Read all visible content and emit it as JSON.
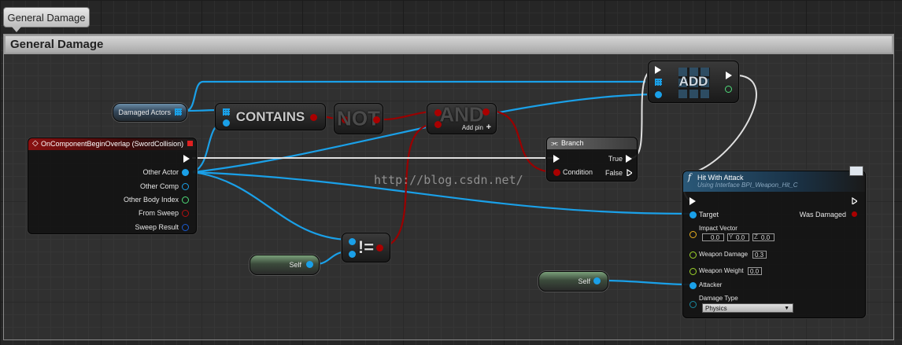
{
  "tab": {
    "label": "General Damage"
  },
  "comment": {
    "title": "General Damage"
  },
  "nodes": {
    "damaged_actors": {
      "label": "Damaged Actors"
    },
    "contains": {
      "label": "CONTAINS"
    },
    "not": {
      "label": "NOT"
    },
    "and": {
      "label": "AND",
      "add_pin": "Add pin"
    },
    "add": {
      "label": "ADD"
    },
    "branch": {
      "title": "Branch",
      "condition": "Condition",
      "true_label": "True",
      "false_label": "False"
    },
    "event": {
      "title": "OnComponentBeginOverlap (SwordCollision)",
      "pins": [
        "Other Actor",
        "Other Comp",
        "Other Body Index",
        "From Sweep",
        "Sweep Result"
      ]
    },
    "self1": {
      "label": "Self"
    },
    "self2": {
      "label": "Self"
    },
    "not_equal": {
      "label": "!="
    },
    "hit": {
      "title": "Hit With Attack",
      "subtitle": "Using Interface BPI_Weapon_Hit_C",
      "target": "Target",
      "was_damaged": "Was Damaged",
      "impact_vector": "Impact Vector",
      "x_label": "X",
      "x": "0.0",
      "y_label": "Y",
      "y": "0.0",
      "z_label": "Z",
      "z": "0.0",
      "weapon_damage": "Weapon Damage",
      "weapon_damage_value": "0.3",
      "weapon_weight": "Weapon Weight",
      "weapon_weight_value": "0.0",
      "attacker": "Attacker",
      "damage_type": "Damage Type",
      "damage_type_value": "Physics"
    }
  },
  "watermark": "http://blog.csdn.net/",
  "colors": {
    "object_pin": "#1aa0e8",
    "bool_pin": "#a00000",
    "exec_wire": "#e0e0e0",
    "event_header": "#8a1010"
  }
}
